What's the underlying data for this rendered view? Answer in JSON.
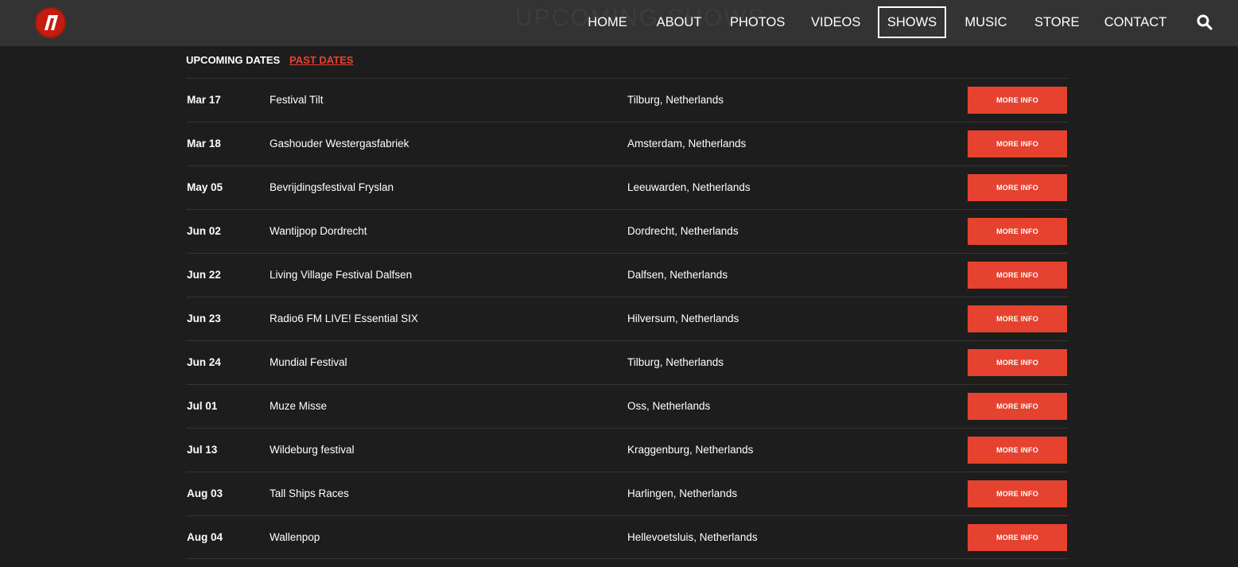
{
  "header": {
    "page_title": "UPCOMING SHOWS",
    "nav": [
      {
        "label": "HOME"
      },
      {
        "label": "ABOUT"
      },
      {
        "label": "PHOTOS"
      },
      {
        "label": "VIDEOS"
      },
      {
        "label": "SHOWS",
        "active": true
      },
      {
        "label": "MUSIC"
      },
      {
        "label": "STORE"
      },
      {
        "label": "CONTACT"
      }
    ],
    "search_icon": "search-icon",
    "logo_icon": "band-logo"
  },
  "tabs": {
    "upcoming": "UPCOMING DATES",
    "past": "PAST DATES"
  },
  "shows": [
    {
      "date": "Mar 17",
      "venue": "Festival Tilt",
      "location": "Tilburg, Netherlands",
      "button": "MORE INFO"
    },
    {
      "date": "Mar 18",
      "venue": "Gashouder Westergasfabriek",
      "location": "Amsterdam, Netherlands",
      "button": "MORE INFO"
    },
    {
      "date": "May 05",
      "venue": "Bevrijdingsfestival Fryslan",
      "location": "Leeuwarden, Netherlands",
      "button": "MORE INFO"
    },
    {
      "date": "Jun 02",
      "venue": "Wantijpop Dordrecht",
      "location": "Dordrecht, Netherlands",
      "button": "MORE INFO"
    },
    {
      "date": "Jun 22",
      "venue": "Living Village Festival Dalfsen",
      "location": "Dalfsen, Netherlands",
      "button": "MORE INFO"
    },
    {
      "date": "Jun 23",
      "venue": "Radio6 FM LIVE! Essential SIX",
      "location": "Hilversum, Netherlands",
      "button": "MORE INFO"
    },
    {
      "date": "Jun 24",
      "venue": "Mundial Festival",
      "location": "Tilburg, Netherlands",
      "button": "MORE INFO"
    },
    {
      "date": "Jul 01",
      "venue": "Muze Misse",
      "location": "Oss, Netherlands",
      "button": "MORE INFO"
    },
    {
      "date": "Jul 13",
      "venue": "Wildeburg festival",
      "location": "Kraggenburg, Netherlands",
      "button": "MORE INFO"
    },
    {
      "date": "Aug 03",
      "venue": "Tall Ships Races",
      "location": "Harlingen, Netherlands",
      "button": "MORE INFO"
    },
    {
      "date": "Aug 04",
      "venue": "Wallenpop",
      "location": "Hellevoetsluis, Netherlands",
      "button": "MORE INFO"
    }
  ],
  "colors": {
    "accent": "#e5432f",
    "header_bg": "#333333",
    "page_bg": "#1d1d1d",
    "logo": "#c41d10"
  }
}
